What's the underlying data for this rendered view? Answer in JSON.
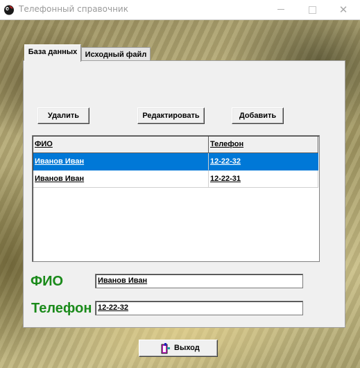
{
  "window": {
    "title": "Телефонный справочник"
  },
  "titlebar": {
    "min_glyph": "—",
    "close_glyph": "✕"
  },
  "tabs": [
    {
      "label": "База данных",
      "active": true
    },
    {
      "label": "Исходный файл",
      "active": false
    }
  ],
  "toolbar": {
    "delete_label": "Удалить",
    "edit_label": "Редактировать",
    "add_label": "Добавить"
  },
  "grid": {
    "columns": [
      "ФИО",
      "Телефон"
    ],
    "rows": [
      {
        "name": "Иванов Иван",
        "phone": "12-22-32",
        "selected": true
      },
      {
        "name": "Иванов Иван",
        "phone": "12-22-31",
        "selected": false
      }
    ]
  },
  "form": {
    "fio_label": "ФИО",
    "fio_value": "Иванов Иван",
    "phone_label": "Телефон",
    "phone_value": "12-22-32"
  },
  "exit": {
    "label": "Выход",
    "icon": "exit-door-icon"
  },
  "colors": {
    "accent_selected": "#0078d7",
    "label_green": "#1a8a1a"
  }
}
